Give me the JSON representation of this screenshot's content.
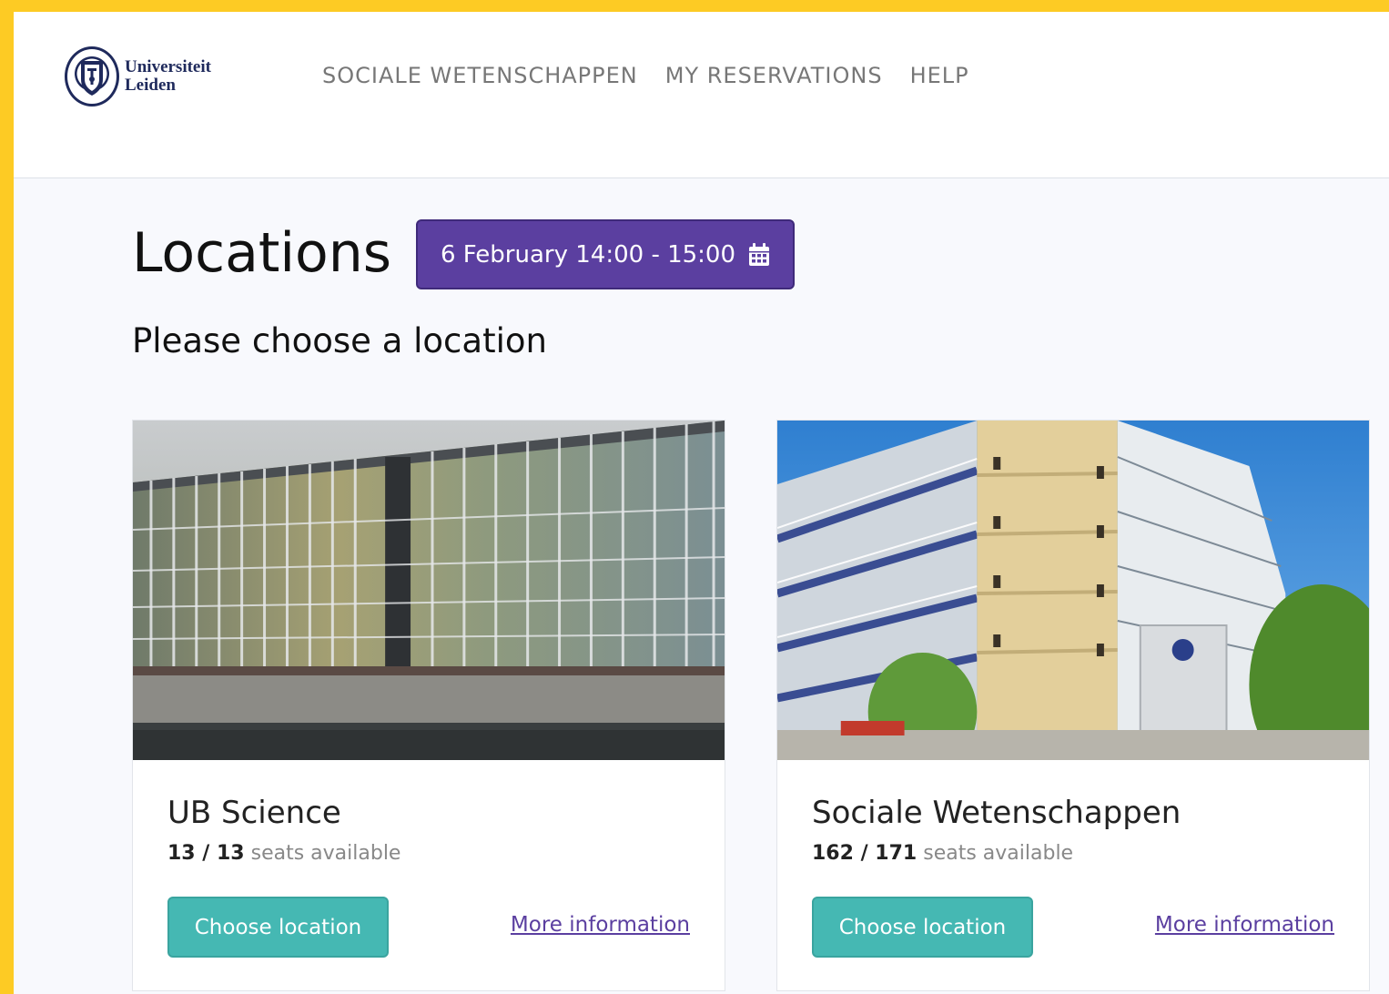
{
  "brand": {
    "line1": "Universiteit",
    "line2": "Leiden"
  },
  "nav": {
    "items": [
      {
        "label": "SOCIALE WETENSCHAPPEN"
      },
      {
        "label": "MY RESERVATIONS"
      },
      {
        "label": "HELP"
      }
    ]
  },
  "page": {
    "title": "Locations",
    "subtitle": "Please choose a location",
    "date_selector": {
      "label": "6 February 14:00 - 15:00",
      "icon": "calendar-icon"
    }
  },
  "locations": [
    {
      "name": "UB Science",
      "seats_available": "13",
      "seats_total": "13",
      "seats_suffix": "seats available",
      "choose_label": "Choose location",
      "more_label": "More information"
    },
    {
      "name": "Sociale Wetenschappen",
      "seats_available": "162",
      "seats_total": "171",
      "seats_suffix": "seats available",
      "choose_label": "Choose location",
      "more_label": "More information"
    }
  ],
  "colors": {
    "frame": "#fdcb24",
    "primary": "#5b3fa0",
    "accent": "#45b8b3",
    "background": "#f8f9fd"
  }
}
